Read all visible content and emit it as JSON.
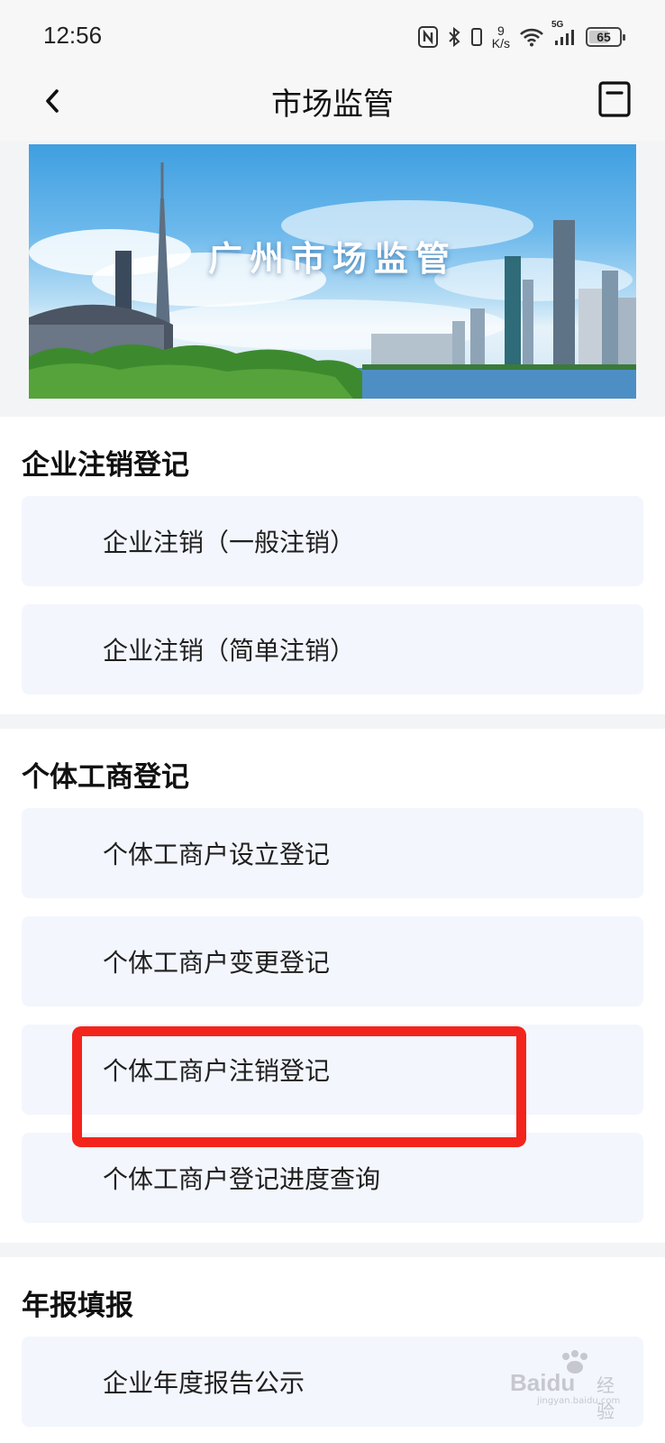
{
  "status_bar": {
    "time": "12:56",
    "net_speed_value": "9",
    "net_speed_unit": "K/s",
    "network_type": "5G",
    "battery": "65",
    "battery_level_percent": 65
  },
  "nav": {
    "title": "市场监管"
  },
  "banner": {
    "title": "广州市场监管"
  },
  "sections": [
    {
      "title": "企业注销登记",
      "items": [
        {
          "label": "企业注销（一般注销）"
        },
        {
          "label": "企业注销（简单注销）"
        }
      ]
    },
    {
      "title": "个体工商登记",
      "items": [
        {
          "label": "个体工商户设立登记"
        },
        {
          "label": "个体工商户变更登记"
        },
        {
          "label": "个体工商户注销登记"
        },
        {
          "label": "个体工商户登记进度查询"
        }
      ]
    },
    {
      "title": "年报填报",
      "items": [
        {
          "label": "企业年度报告公示"
        }
      ]
    }
  ],
  "watermark": {
    "brand": "Baidu",
    "cn": "经验",
    "url": "jingyan.baidu.com"
  },
  "colors": {
    "highlight": "#f3241b",
    "item_bg": "#f3f6fd",
    "page_bg": "#f3f4f6"
  }
}
